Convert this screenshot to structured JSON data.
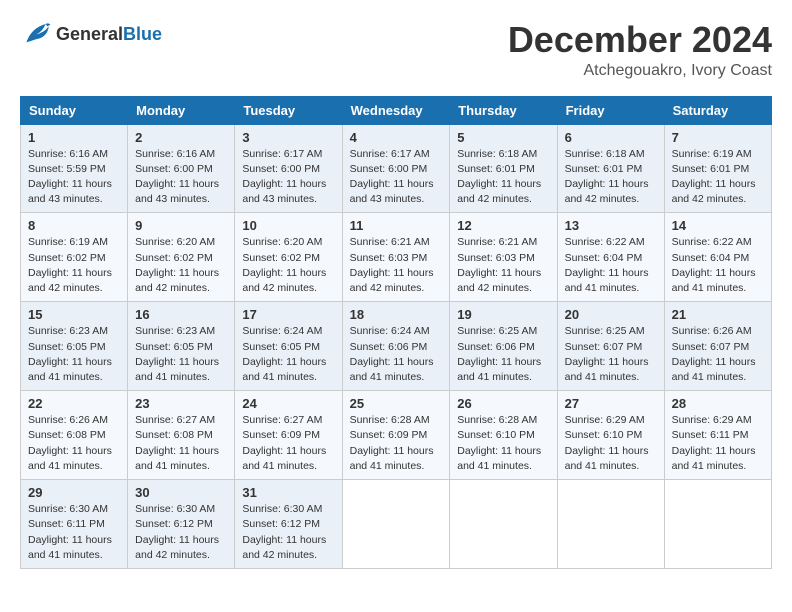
{
  "header": {
    "logo_general": "General",
    "logo_blue": "Blue",
    "month_title": "December 2024",
    "location": "Atchegouakro, Ivory Coast"
  },
  "weekdays": [
    "Sunday",
    "Monday",
    "Tuesday",
    "Wednesday",
    "Thursday",
    "Friday",
    "Saturday"
  ],
  "weeks": [
    [
      {
        "day": "1",
        "sunrise": "Sunrise: 6:16 AM",
        "sunset": "Sunset: 5:59 PM",
        "daylight": "Daylight: 11 hours and 43 minutes."
      },
      {
        "day": "2",
        "sunrise": "Sunrise: 6:16 AM",
        "sunset": "Sunset: 6:00 PM",
        "daylight": "Daylight: 11 hours and 43 minutes."
      },
      {
        "day": "3",
        "sunrise": "Sunrise: 6:17 AM",
        "sunset": "Sunset: 6:00 PM",
        "daylight": "Daylight: 11 hours and 43 minutes."
      },
      {
        "day": "4",
        "sunrise": "Sunrise: 6:17 AM",
        "sunset": "Sunset: 6:00 PM",
        "daylight": "Daylight: 11 hours and 43 minutes."
      },
      {
        "day": "5",
        "sunrise": "Sunrise: 6:18 AM",
        "sunset": "Sunset: 6:01 PM",
        "daylight": "Daylight: 11 hours and 42 minutes."
      },
      {
        "day": "6",
        "sunrise": "Sunrise: 6:18 AM",
        "sunset": "Sunset: 6:01 PM",
        "daylight": "Daylight: 11 hours and 42 minutes."
      },
      {
        "day": "7",
        "sunrise": "Sunrise: 6:19 AM",
        "sunset": "Sunset: 6:01 PM",
        "daylight": "Daylight: 11 hours and 42 minutes."
      }
    ],
    [
      {
        "day": "8",
        "sunrise": "Sunrise: 6:19 AM",
        "sunset": "Sunset: 6:02 PM",
        "daylight": "Daylight: 11 hours and 42 minutes."
      },
      {
        "day": "9",
        "sunrise": "Sunrise: 6:20 AM",
        "sunset": "Sunset: 6:02 PM",
        "daylight": "Daylight: 11 hours and 42 minutes."
      },
      {
        "day": "10",
        "sunrise": "Sunrise: 6:20 AM",
        "sunset": "Sunset: 6:02 PM",
        "daylight": "Daylight: 11 hours and 42 minutes."
      },
      {
        "day": "11",
        "sunrise": "Sunrise: 6:21 AM",
        "sunset": "Sunset: 6:03 PM",
        "daylight": "Daylight: 11 hours and 42 minutes."
      },
      {
        "day": "12",
        "sunrise": "Sunrise: 6:21 AM",
        "sunset": "Sunset: 6:03 PM",
        "daylight": "Daylight: 11 hours and 42 minutes."
      },
      {
        "day": "13",
        "sunrise": "Sunrise: 6:22 AM",
        "sunset": "Sunset: 6:04 PM",
        "daylight": "Daylight: 11 hours and 41 minutes."
      },
      {
        "day": "14",
        "sunrise": "Sunrise: 6:22 AM",
        "sunset": "Sunset: 6:04 PM",
        "daylight": "Daylight: 11 hours and 41 minutes."
      }
    ],
    [
      {
        "day": "15",
        "sunrise": "Sunrise: 6:23 AM",
        "sunset": "Sunset: 6:05 PM",
        "daylight": "Daylight: 11 hours and 41 minutes."
      },
      {
        "day": "16",
        "sunrise": "Sunrise: 6:23 AM",
        "sunset": "Sunset: 6:05 PM",
        "daylight": "Daylight: 11 hours and 41 minutes."
      },
      {
        "day": "17",
        "sunrise": "Sunrise: 6:24 AM",
        "sunset": "Sunset: 6:05 PM",
        "daylight": "Daylight: 11 hours and 41 minutes."
      },
      {
        "day": "18",
        "sunrise": "Sunrise: 6:24 AM",
        "sunset": "Sunset: 6:06 PM",
        "daylight": "Daylight: 11 hours and 41 minutes."
      },
      {
        "day": "19",
        "sunrise": "Sunrise: 6:25 AM",
        "sunset": "Sunset: 6:06 PM",
        "daylight": "Daylight: 11 hours and 41 minutes."
      },
      {
        "day": "20",
        "sunrise": "Sunrise: 6:25 AM",
        "sunset": "Sunset: 6:07 PM",
        "daylight": "Daylight: 11 hours and 41 minutes."
      },
      {
        "day": "21",
        "sunrise": "Sunrise: 6:26 AM",
        "sunset": "Sunset: 6:07 PM",
        "daylight": "Daylight: 11 hours and 41 minutes."
      }
    ],
    [
      {
        "day": "22",
        "sunrise": "Sunrise: 6:26 AM",
        "sunset": "Sunset: 6:08 PM",
        "daylight": "Daylight: 11 hours and 41 minutes."
      },
      {
        "day": "23",
        "sunrise": "Sunrise: 6:27 AM",
        "sunset": "Sunset: 6:08 PM",
        "daylight": "Daylight: 11 hours and 41 minutes."
      },
      {
        "day": "24",
        "sunrise": "Sunrise: 6:27 AM",
        "sunset": "Sunset: 6:09 PM",
        "daylight": "Daylight: 11 hours and 41 minutes."
      },
      {
        "day": "25",
        "sunrise": "Sunrise: 6:28 AM",
        "sunset": "Sunset: 6:09 PM",
        "daylight": "Daylight: 11 hours and 41 minutes."
      },
      {
        "day": "26",
        "sunrise": "Sunrise: 6:28 AM",
        "sunset": "Sunset: 6:10 PM",
        "daylight": "Daylight: 11 hours and 41 minutes."
      },
      {
        "day": "27",
        "sunrise": "Sunrise: 6:29 AM",
        "sunset": "Sunset: 6:10 PM",
        "daylight": "Daylight: 11 hours and 41 minutes."
      },
      {
        "day": "28",
        "sunrise": "Sunrise: 6:29 AM",
        "sunset": "Sunset: 6:11 PM",
        "daylight": "Daylight: 11 hours and 41 minutes."
      }
    ],
    [
      {
        "day": "29",
        "sunrise": "Sunrise: 6:30 AM",
        "sunset": "Sunset: 6:11 PM",
        "daylight": "Daylight: 11 hours and 41 minutes."
      },
      {
        "day": "30",
        "sunrise": "Sunrise: 6:30 AM",
        "sunset": "Sunset: 6:12 PM",
        "daylight": "Daylight: 11 hours and 42 minutes."
      },
      {
        "day": "31",
        "sunrise": "Sunrise: 6:30 AM",
        "sunset": "Sunset: 6:12 PM",
        "daylight": "Daylight: 11 hours and 42 minutes."
      },
      null,
      null,
      null,
      null
    ]
  ]
}
